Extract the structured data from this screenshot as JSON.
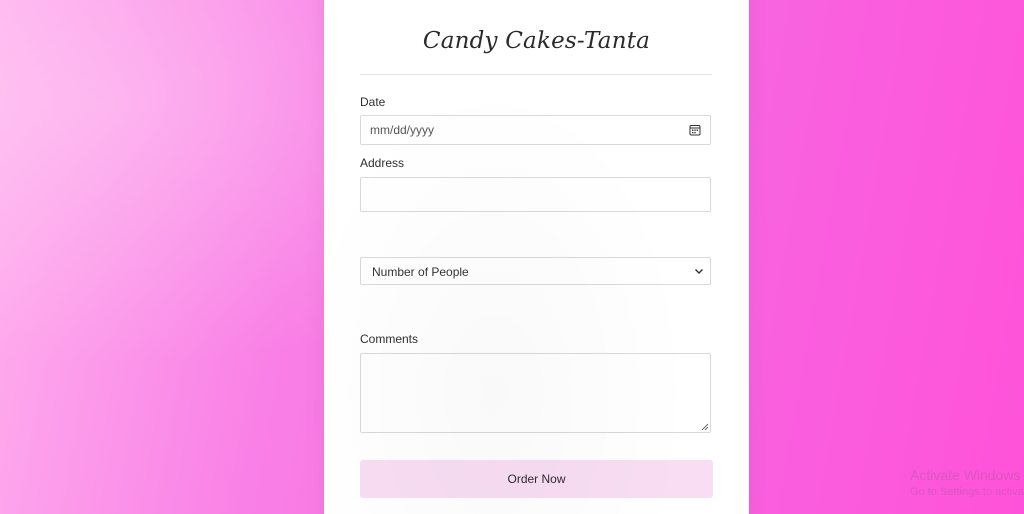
{
  "form": {
    "title": "Candy Cakes-Tanta",
    "date": {
      "label": "Date",
      "placeholder": "mm/dd/yyyy",
      "icon": "calendar-icon"
    },
    "address": {
      "label": "Address",
      "value": ""
    },
    "people": {
      "selected": "Number of People",
      "icon": "chevron-down-icon"
    },
    "comments": {
      "label": "Comments",
      "value": ""
    },
    "submit_label": "Order Now"
  },
  "watermark": {
    "title": "Activate Windows",
    "subtitle": "Go to Settings to activate Windows."
  },
  "colors": {
    "background_left": "#ffb1ee",
    "background_right": "#ff52da",
    "card": "#ffffff",
    "button": "#f8ddf3"
  }
}
